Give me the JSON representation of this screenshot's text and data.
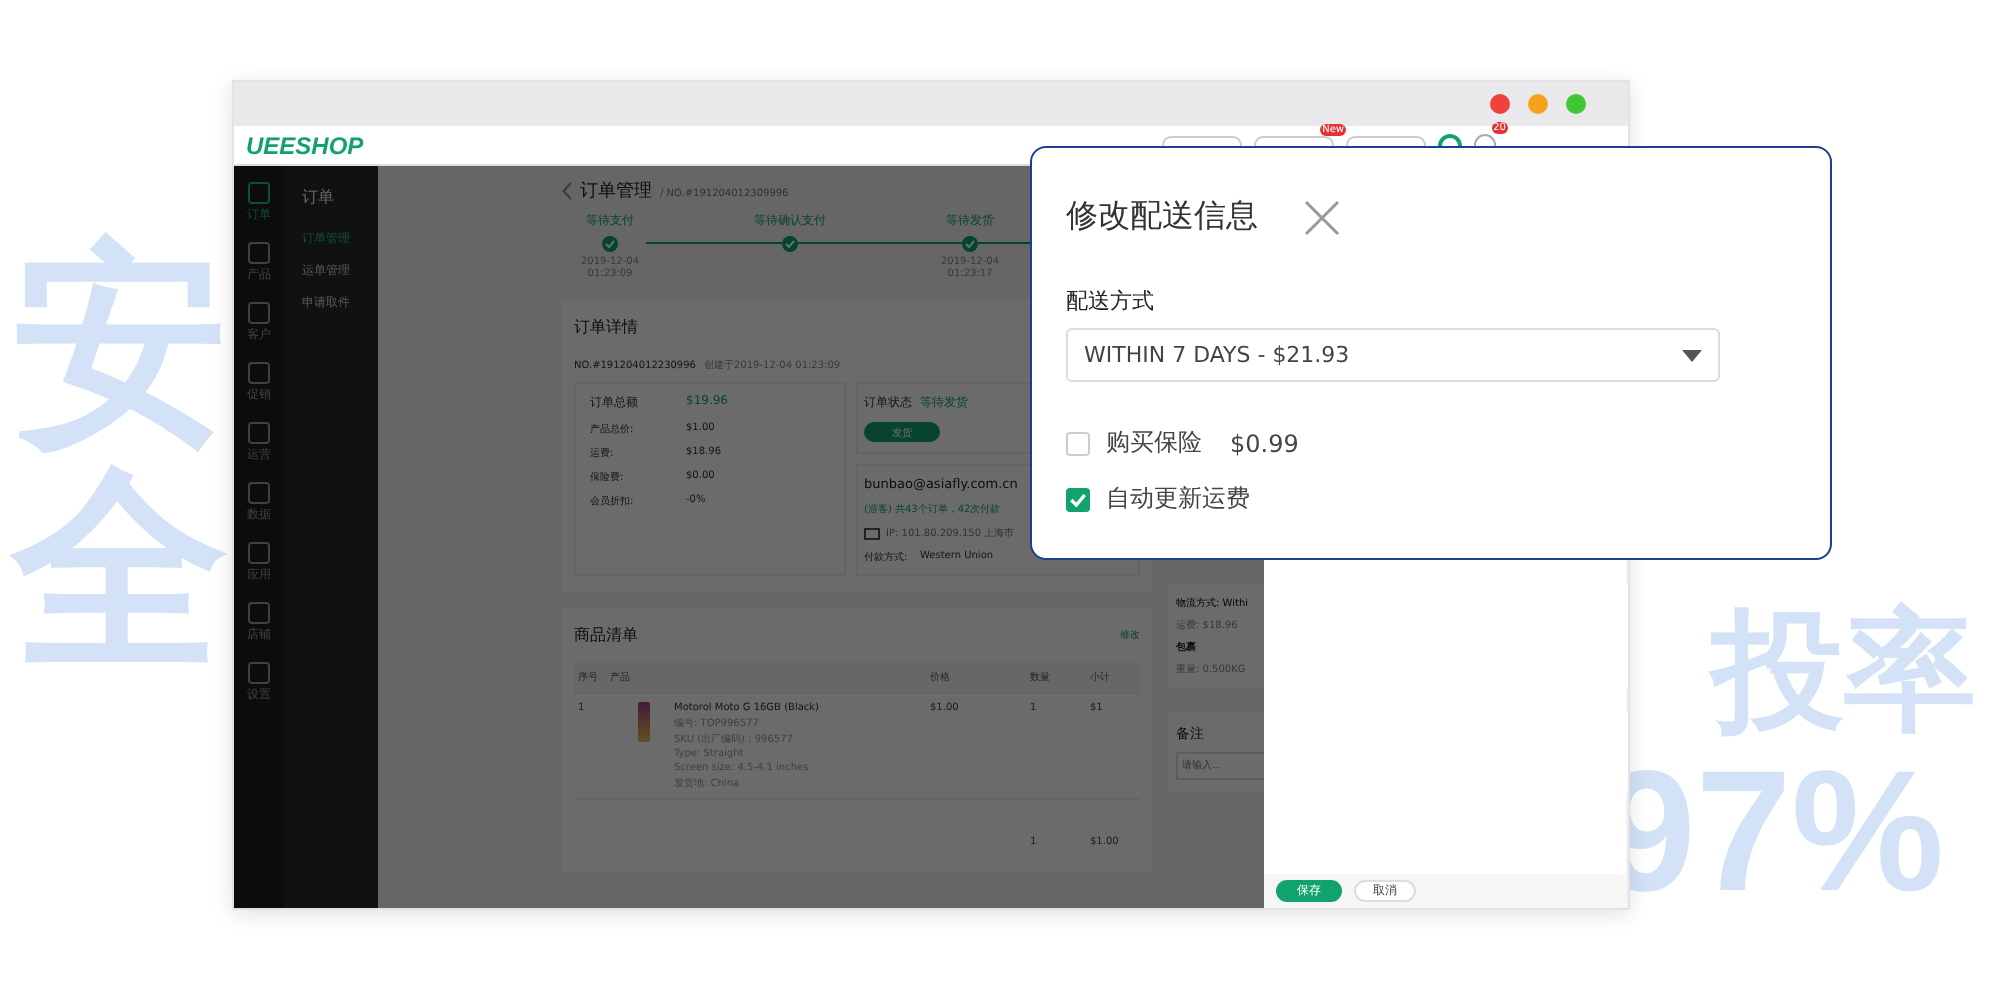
{
  "backdrop_text": {
    "left": "安全",
    "right_title": "投率",
    "right_value": "97%"
  },
  "browser": {
    "controls": [
      {
        "color": "#f0413a"
      },
      {
        "color": "#f7a01c"
      },
      {
        "color": "#3fc833"
      }
    ]
  },
  "header": {
    "logo": "UEESHOP",
    "badges": [
      "New",
      "20"
    ]
  },
  "nav": [
    {
      "label": "订单",
      "selected": true
    },
    {
      "label": "产品",
      "selected": false
    },
    {
      "label": "客户",
      "selected": false
    },
    {
      "label": "促销",
      "selected": false
    },
    {
      "label": "运营",
      "selected": false
    },
    {
      "label": "数据",
      "selected": false
    },
    {
      "label": "应用",
      "selected": false
    },
    {
      "label": "店铺",
      "selected": false
    },
    {
      "label": "设置",
      "selected": false
    }
  ],
  "sidebar": {
    "title": "订单",
    "items": [
      {
        "label": "订单管理",
        "selected": true
      },
      {
        "label": "运单管理",
        "selected": false
      },
      {
        "label": "申请取件",
        "selected": false
      }
    ]
  },
  "page": {
    "title": "订单管理",
    "crumb": "/ NO.#191204012309996"
  },
  "steps": [
    {
      "label": "等待支付",
      "date": "2019-12-04",
      "time": "01:23:09",
      "done": true
    },
    {
      "label": "等待确认支付",
      "done": true
    },
    {
      "label": "等待发货",
      "date": "2019-12-04",
      "time": "01:23:17",
      "done": true
    }
  ],
  "details": {
    "title": "订单详情",
    "number": "NO.#191204012230996",
    "created": "创建于2019-12-04 01:23:09",
    "total_label": "订单总额",
    "total": "$19.96",
    "lines": [
      {
        "label": "产品总价:",
        "value": "$1.00"
      },
      {
        "label": "运费:",
        "value": "$18.96"
      },
      {
        "label": "保险费:",
        "value": "$0.00"
      },
      {
        "label": "会员折扣:",
        "value": "-0%"
      }
    ],
    "status_label": "订单状态",
    "status": "等待发货",
    "ship_button": "发货",
    "email": "bunbao@asiafly.com.cn",
    "orders_note": "(游客) 共43个订单，42次付款",
    "ip": "IP: 101.80.209.150 上海市",
    "payment_label": "付款方式:",
    "payment": "Western Union"
  },
  "shipping": {
    "method": "物流方式: Withi",
    "fee": "运费: $18.96",
    "package": "包裹",
    "weight": "重量: 0.500KG"
  },
  "products": {
    "title": "商品清单",
    "edit": "修改",
    "columns": [
      "序号",
      "产品",
      "价格",
      "数量",
      "小计"
    ],
    "rows": [
      {
        "index": "1",
        "name": "Motorol Moto G 16GB (Black)",
        "specs": [
          "编号: TOP996577",
          "SKU (出厂编码) : 996577",
          "Type: Straight",
          "Screen size: 4.5-4.1 inches",
          "发货地: China"
        ],
        "price": "$1.00",
        "qty": "1",
        "subtotal": "$1"
      }
    ],
    "footer": {
      "qty": "1",
      "total": "$1.00"
    }
  },
  "remarks": {
    "title": "备注",
    "placeholder": "请输入..."
  },
  "drawer": {
    "save": "保存",
    "cancel": "取消"
  },
  "dialog": {
    "title": "修改配送信息",
    "field_label": "配送方式",
    "selected_option": "WITHIN 7 DAYS - $21.93",
    "options": [
      {
        "label": "购买保险",
        "price": "$0.99",
        "checked": false
      },
      {
        "label": "自动更新运费",
        "checked": true
      }
    ]
  }
}
